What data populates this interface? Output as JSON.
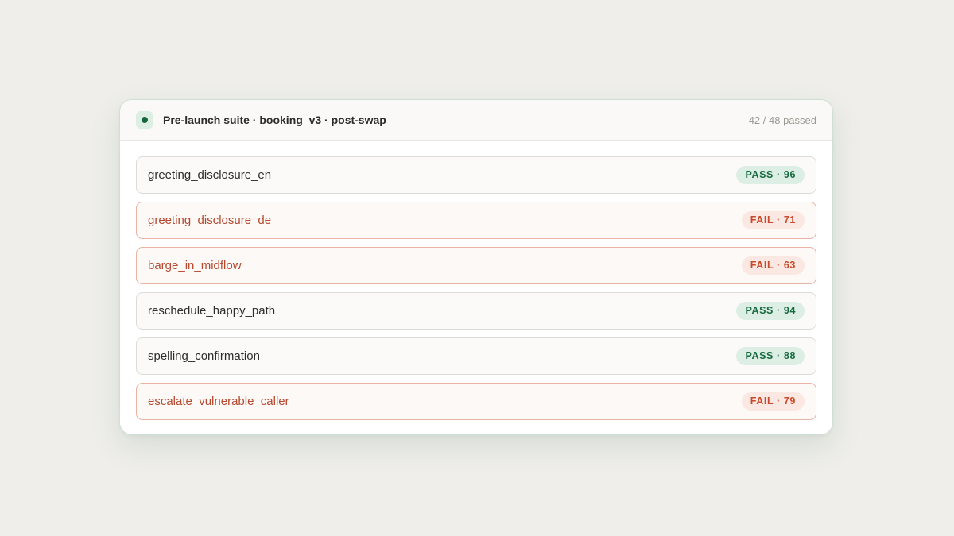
{
  "suite": {
    "title": "Pre-launch suite · booking_v3 · post-swap",
    "summary": "42 / 48 passed",
    "status_icon": "status-dot-icon",
    "colors": {
      "pass_text": "#17693f",
      "pass_bg": "#ddeee4",
      "fail_text": "#c8492b",
      "fail_bg": "#fbe8e2",
      "fail_name": "#b4492f"
    }
  },
  "tests": [
    {
      "name": "greeting_disclosure_en",
      "status": "pass",
      "badge": "PASS · 96"
    },
    {
      "name": "greeting_disclosure_de",
      "status": "fail",
      "badge": "FAIL · 71"
    },
    {
      "name": "barge_in_midflow",
      "status": "fail",
      "badge": "FAIL · 63"
    },
    {
      "name": "reschedule_happy_path",
      "status": "pass",
      "badge": "PASS · 94"
    },
    {
      "name": "spelling_confirmation",
      "status": "pass",
      "badge": "PASS · 88"
    },
    {
      "name": "escalate_vulnerable_caller",
      "status": "fail",
      "badge": "FAIL · 79"
    }
  ]
}
